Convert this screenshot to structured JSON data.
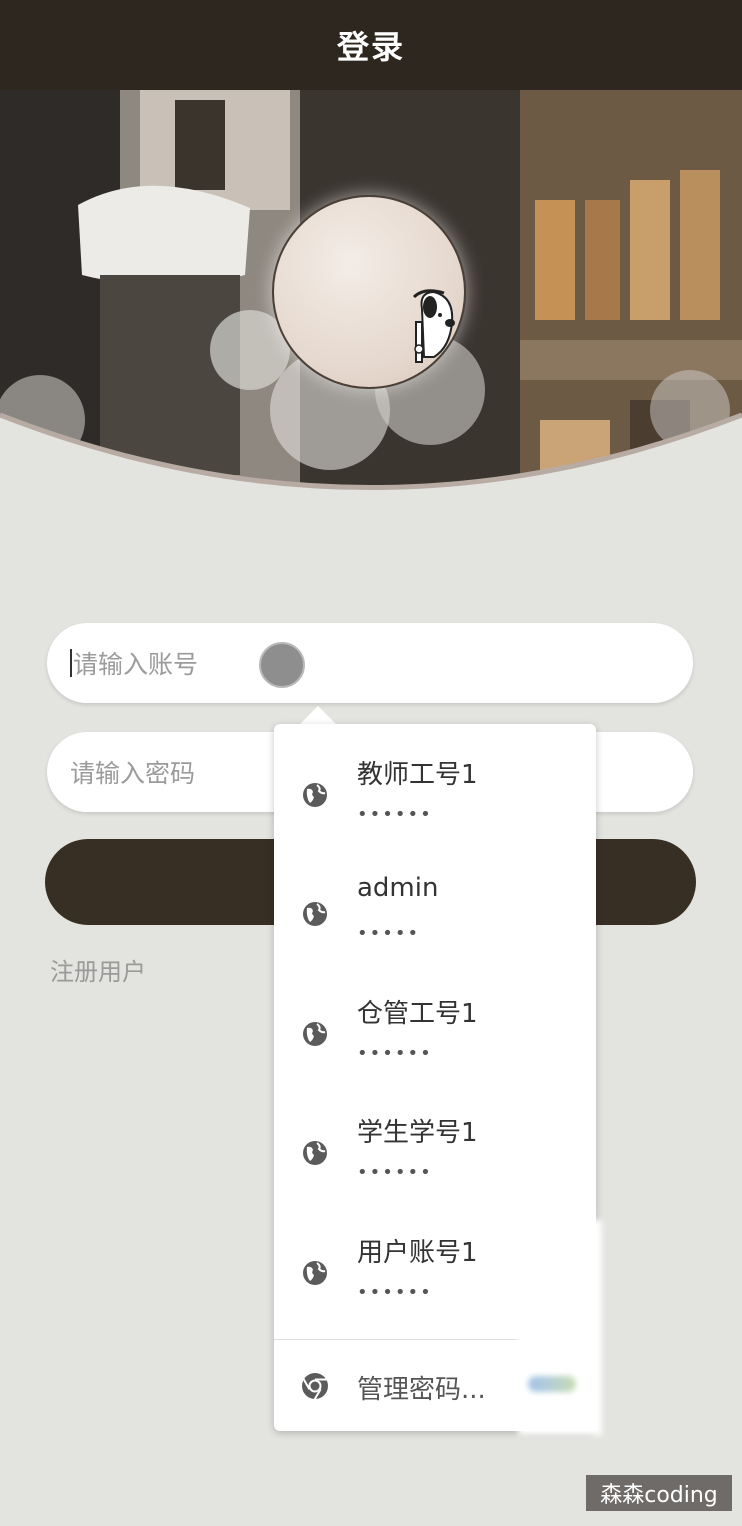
{
  "header": {
    "title": "登录"
  },
  "form": {
    "account_placeholder": "请输入账号",
    "password_placeholder": "请输入密码",
    "login_button_label": "",
    "register_link": "注册用户"
  },
  "autofill": {
    "items": [
      {
        "username": "教师工号1",
        "password_mask": "••••••"
      },
      {
        "username": "admin",
        "password_mask": "•••••"
      },
      {
        "username": "仓管工号1",
        "password_mask": "••••••"
      },
      {
        "username": "学生学号1",
        "password_mask": "••••••"
      },
      {
        "username": "用户账号1",
        "password_mask": "••••••"
      }
    ],
    "manage_label": "管理密码...",
    "item_icon": "globe-icon",
    "manage_icon": "chrome-icon"
  },
  "watermark": "森森coding",
  "colors": {
    "header_bg": "#2e271f",
    "page_bg": "#e3e4e0",
    "button_bg": "#382f24"
  }
}
